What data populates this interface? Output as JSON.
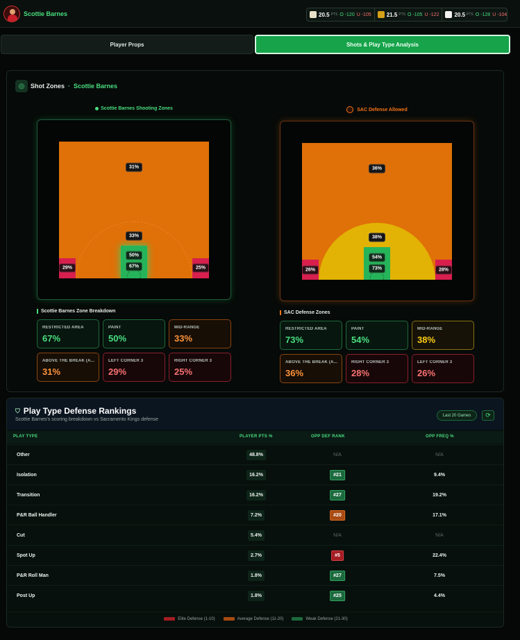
{
  "header": {
    "player_name": "Scottie Barnes",
    "books": [
      {
        "icon": "book-logo-1",
        "color": "#e8e0c8",
        "line": "20.5",
        "unit": "PTS",
        "over": "O -120",
        "under": "U -105"
      },
      {
        "icon": "book-logo-2",
        "color": "#d4a017",
        "line": "21.5",
        "unit": "PTS",
        "over": "O -105",
        "under": "U -122"
      },
      {
        "icon": "book-logo-3",
        "color": "#f2f2f2",
        "line": "20.5",
        "unit": "PTS",
        "over": "O -128",
        "under": "U -104"
      }
    ]
  },
  "tabs": {
    "player_props": "Player Props",
    "shots_analysis": "Shots & Play Type Analysis"
  },
  "shot_zones": {
    "title": "Shot Zones",
    "separator": "·",
    "player": "Scottie Barnes",
    "left": {
      "label": "Scottie Barnes Shooting Zones",
      "zones": {
        "above_break": "31%",
        "mid_range": "33%",
        "paint": "50%",
        "restricted": "67%",
        "left_corner": "29%",
        "right_corner": "25%"
      },
      "breakdown_title": "Scottie Barnes Zone Breakdown",
      "cards": [
        {
          "label": "RESTRICTED AREA",
          "value": "67%",
          "tone": "green"
        },
        {
          "label": "PAINT",
          "value": "50%",
          "tone": "green"
        },
        {
          "label": "MID-RANGE",
          "value": "33%",
          "tone": "orange"
        },
        {
          "label": "ABOVE THE BREAK (A...",
          "value": "31%",
          "tone": "orange"
        },
        {
          "label": "LEFT CORNER 3",
          "value": "29%",
          "tone": "red"
        },
        {
          "label": "RIGHT CORNER 3",
          "value": "25%",
          "tone": "red"
        }
      ]
    },
    "right": {
      "label": "SAC Defense Allowed",
      "zones": {
        "above_break": "36%",
        "mid_range": "38%",
        "paint": "54%",
        "restricted": "73%",
        "left_corner": "26%",
        "right_corner": "28%"
      },
      "breakdown_title": "SAC Defense Zones",
      "cards": [
        {
          "label": "RESTRICTED AREA",
          "value": "73%",
          "tone": "green"
        },
        {
          "label": "PAINT",
          "value": "54%",
          "tone": "green"
        },
        {
          "label": "MID-RANGE",
          "value": "38%",
          "tone": "yellow"
        },
        {
          "label": "ABOVE THE BREAK (A...",
          "value": "36%",
          "tone": "orange"
        },
        {
          "label": "RIGHT CORNER 3",
          "value": "28%",
          "tone": "red"
        },
        {
          "label": "LEFT CORNER 3",
          "value": "26%",
          "tone": "red"
        }
      ]
    }
  },
  "play_type": {
    "title": "Play Type Defense Rankings",
    "subtitle": "Scottie Barnes's scoring breakdown vs Sacramento Kings defense",
    "filter": "Last 20 Games",
    "columns": {
      "type": "PLAY TYPE",
      "pts": "PLAYER PTS %",
      "rank": "OPP DEF RANK",
      "freq": "OPP FREQ %"
    },
    "rows": [
      {
        "type": "Other",
        "pts": "48.8%",
        "rank": "N/A",
        "tier": "none",
        "freq": "N/A"
      },
      {
        "type": "Isolation",
        "pts": "16.2%",
        "rank": "#21",
        "tier": "weak",
        "freq": "9.4%"
      },
      {
        "type": "Transition",
        "pts": "16.2%",
        "rank": "#27",
        "tier": "weak",
        "freq": "19.2%"
      },
      {
        "type": "P&R Ball Handler",
        "pts": "7.2%",
        "rank": "#20",
        "tier": "avg",
        "freq": "17.1%"
      },
      {
        "type": "Cut",
        "pts": "5.4%",
        "rank": "N/A",
        "tier": "none",
        "freq": "N/A"
      },
      {
        "type": "Spot Up",
        "pts": "2.7%",
        "rank": "#5",
        "tier": "elite",
        "freq": "22.4%"
      },
      {
        "type": "P&R Roll Man",
        "pts": "1.8%",
        "rank": "#27",
        "tier": "weak",
        "freq": "7.5%"
      },
      {
        "type": "Post Up",
        "pts": "1.8%",
        "rank": "#25",
        "tier": "weak",
        "freq": "4.4%"
      }
    ],
    "legend": [
      {
        "label": "Elite Defense (1-10)",
        "color": "#a41d22"
      },
      {
        "label": "Average Defense (11-20)",
        "color": "#a84a12"
      },
      {
        "label": "Weak Defense (21-30)",
        "color": "#1b6a3d"
      }
    ]
  }
}
